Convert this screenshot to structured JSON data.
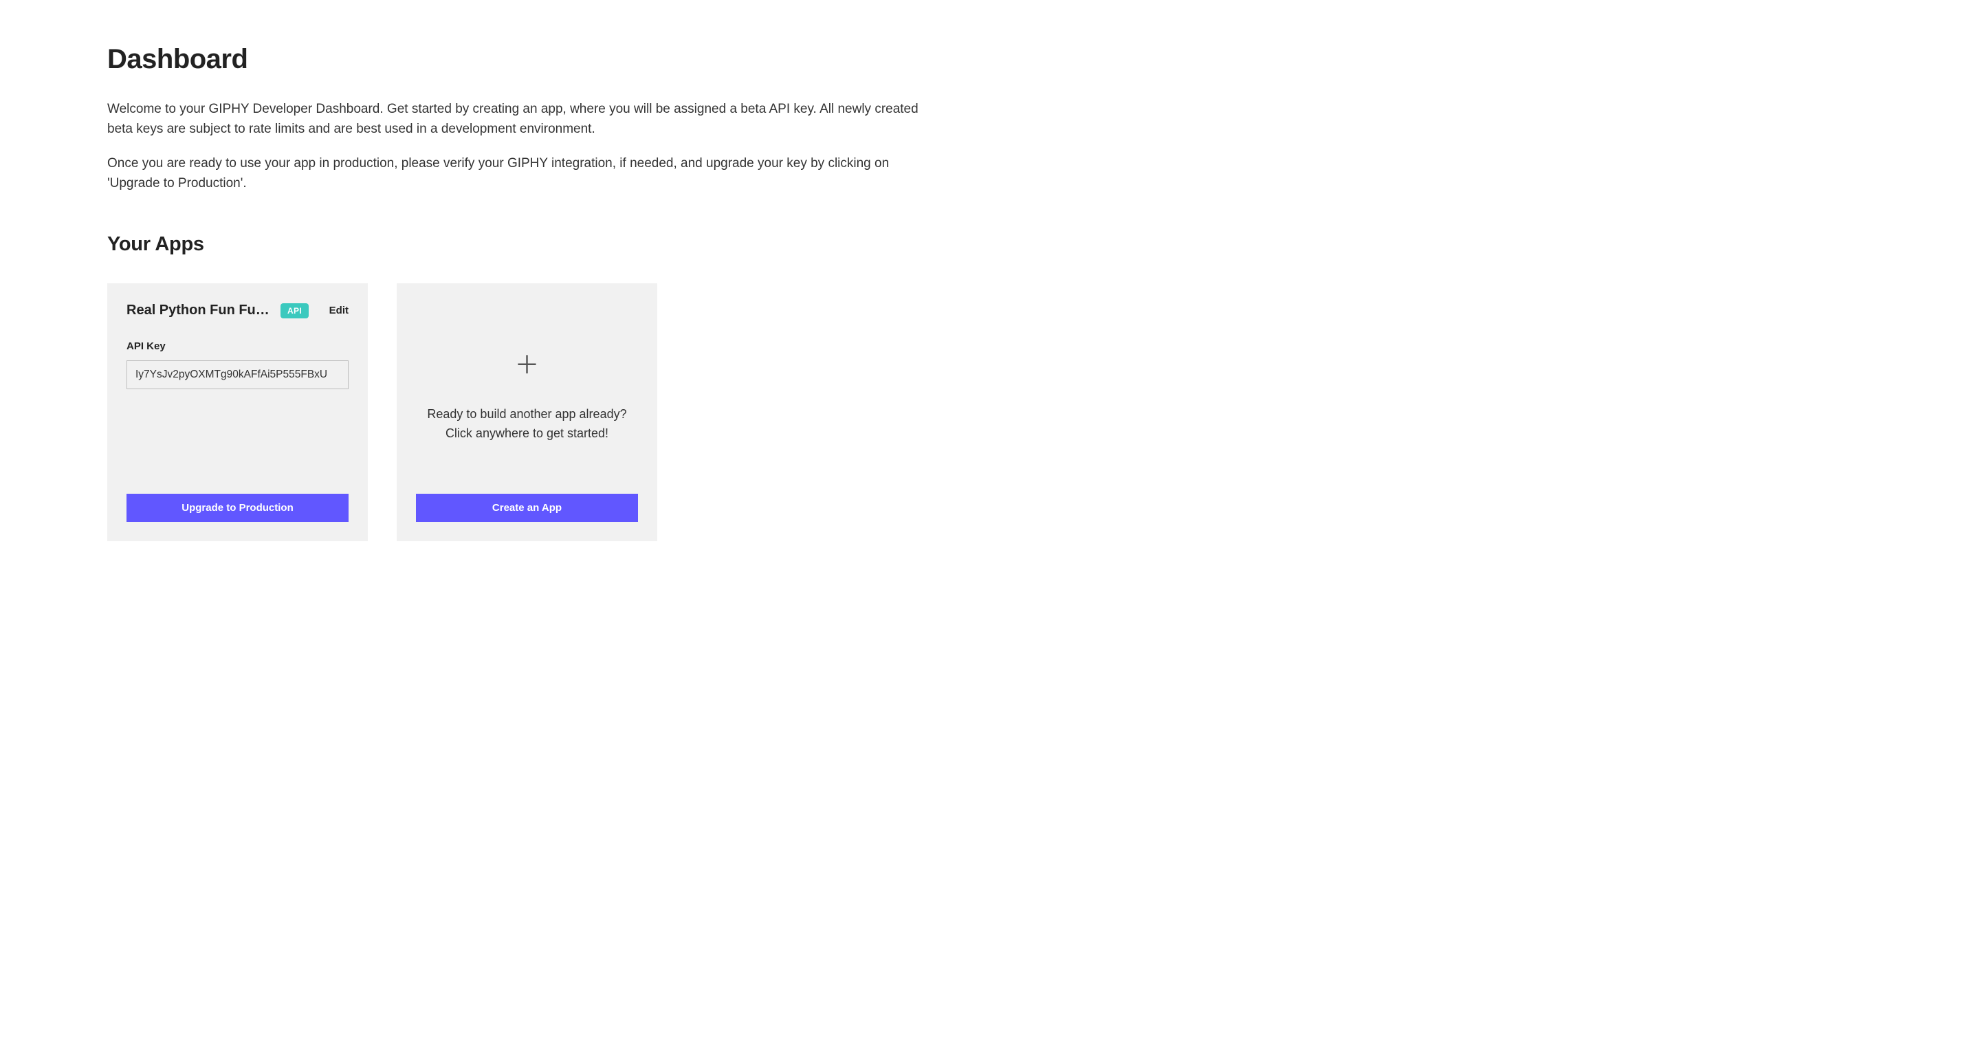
{
  "header": {
    "title": "Dashboard",
    "intro1": "Welcome to your GIPHY Developer Dashboard. Get started by creating an app, where you will be assigned a beta API key. All newly created beta keys are subject to rate limits and are best used in a development environment.",
    "intro2": "Once you are ready to use your app in production, please verify your GIPHY integration, if needed, and upgrade your key by clicking on 'Upgrade to Production'."
  },
  "apps_section": {
    "title": "Your Apps"
  },
  "app_card": {
    "name": "Real Python Fun Fun F…",
    "badge": "API",
    "edit_label": "Edit",
    "api_key_label": "API Key",
    "api_key_value": "Iy7YsJv2pyOXMTg90kAFfAi5P555FBxU",
    "upgrade_button": "Upgrade to Production"
  },
  "new_app_card": {
    "line1": "Ready to build another app already?",
    "line2": "Click anywhere to get started!",
    "create_button": "Create an App"
  }
}
